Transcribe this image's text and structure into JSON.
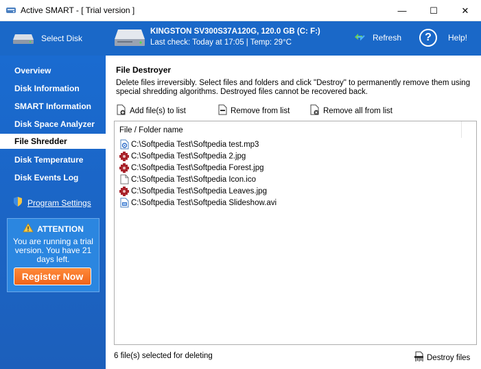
{
  "window": {
    "title": "Active SMART - [ Trial version ]",
    "controls": {
      "minimize": "—",
      "maximize": "☐",
      "close": "✕"
    }
  },
  "header": {
    "select_disk_label": "Select Disk",
    "drive_name": "KINGSTON SV300S37A120G, 120.0 GB (C: F:)",
    "drive_status": "Last check: Today at 17:05 | Temp: 29°C",
    "refresh_label": "Refresh",
    "help_label": "Help!",
    "help_glyph": "?"
  },
  "sidebar": {
    "items": [
      {
        "label": "Overview",
        "active": false
      },
      {
        "label": "Disk Information",
        "active": false
      },
      {
        "label": "SMART Information",
        "active": false
      },
      {
        "label": "Disk Space Analyzer",
        "active": false
      },
      {
        "label": "File Shredder",
        "active": true
      },
      {
        "label": "Disk Temperature",
        "active": false
      },
      {
        "label": "Disk Events Log",
        "active": false
      }
    ],
    "settings_label": "Program Settings",
    "trial": {
      "heading": "ATTENTION",
      "message": "You are running a trial version. You have 21 days left.",
      "register_label": "Register Now"
    }
  },
  "main": {
    "title": "File Destroyer",
    "description": "Delete files irreversibly. Select files and folders and click \"Destroy\" to permanently remove them using special shredding algorithms. Destroyed files cannot be recovered back.",
    "toolbar": {
      "add_label": "Add file(s) to list",
      "remove_label": "Remove from list",
      "remove_all_label": "Remove all from list"
    },
    "list": {
      "column_header": "File / Folder name",
      "files": [
        {
          "name": "C:\\Softpedia Test\\Softpedia test.mp3",
          "icon": "audio-file-icon"
        },
        {
          "name": "C:\\Softpedia Test\\Softpedia 2.jpg",
          "icon": "image-file-icon"
        },
        {
          "name": "C:\\Softpedia Test\\Softpedia Forest.jpg",
          "icon": "image-file-icon"
        },
        {
          "name": "C:\\Softpedia Test\\Softpedia Icon.ico",
          "icon": "blank-file-icon"
        },
        {
          "name": "C:\\Softpedia Test\\Softpedia Leaves.jpg",
          "icon": "image-file-icon"
        },
        {
          "name": "C:\\Softpedia Test\\Softpedia Slideshow.avi",
          "icon": "video-file-icon"
        }
      ]
    },
    "status_text": "6 file(s) selected for deleting",
    "destroy_label": "Destroy files"
  },
  "colors": {
    "header_blue": "#1a68c8",
    "sidebar_blue": "#1c62c2",
    "accent_orange": "#f0641a"
  }
}
